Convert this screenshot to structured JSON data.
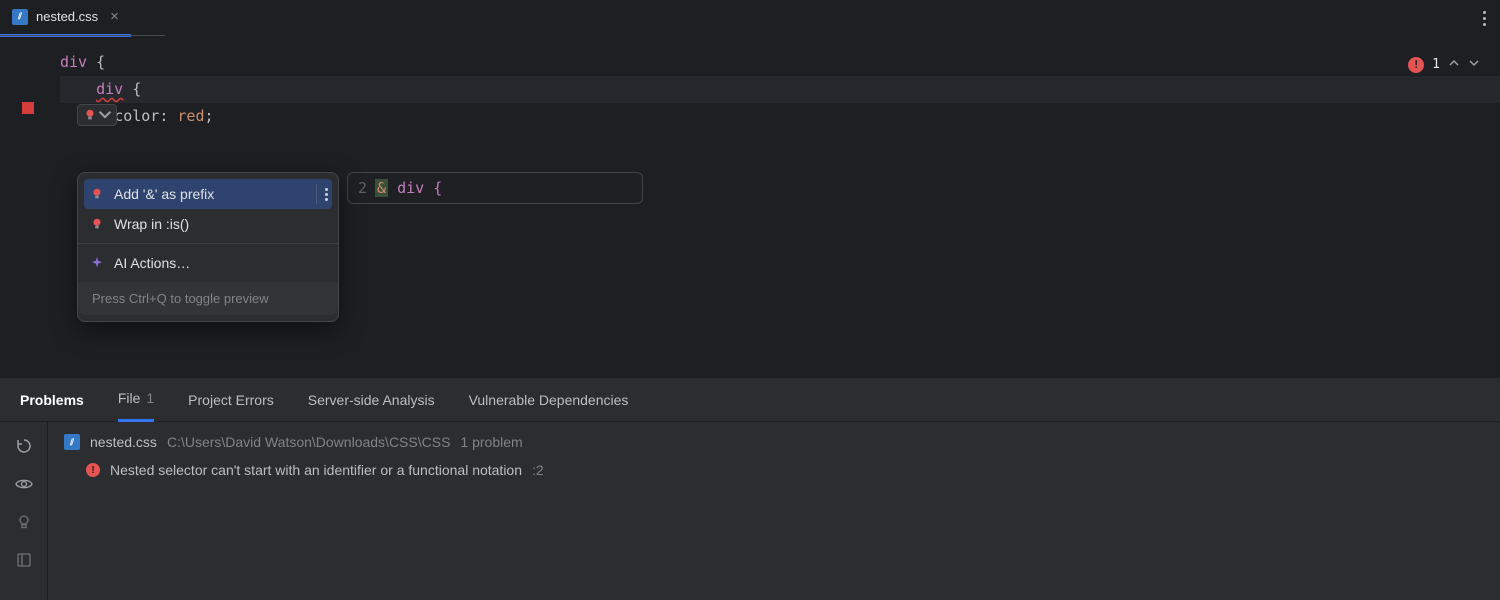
{
  "tab": {
    "filename": "nested.css"
  },
  "editor": {
    "lines": {
      "l1_sel": "div",
      "l1_punc": " {",
      "l2_indent": "    ",
      "l2_sel": "div",
      "l2_punc": " {",
      "l3_indent": "        ",
      "l3_prop": "color",
      "l3_colon": ": ",
      "l3_val": "red",
      "l3_semi": ";"
    },
    "error_count": "1"
  },
  "quickfix": {
    "items": {
      "add_prefix": "Add '&' as prefix",
      "wrap_is": "Wrap in :is()",
      "ai_actions": "AI Actions…"
    },
    "hint": "Press Ctrl+Q to toggle preview"
  },
  "preview": {
    "line_no": "2",
    "amp": "&",
    "rest": " div {"
  },
  "problems": {
    "tabs": {
      "problems": "Problems",
      "file": "File",
      "file_count": "1",
      "project_errors": "Project Errors",
      "server_side": "Server-side Analysis",
      "vuln": "Vulnerable Dependencies"
    },
    "file": {
      "name": "nested.css",
      "path": "C:\\Users\\David Watson\\Downloads\\CSS\\CSS",
      "summary": "1 problem"
    },
    "entry": {
      "message": "Nested selector can't start with an identifier or a functional notation",
      "location": ":2"
    }
  }
}
